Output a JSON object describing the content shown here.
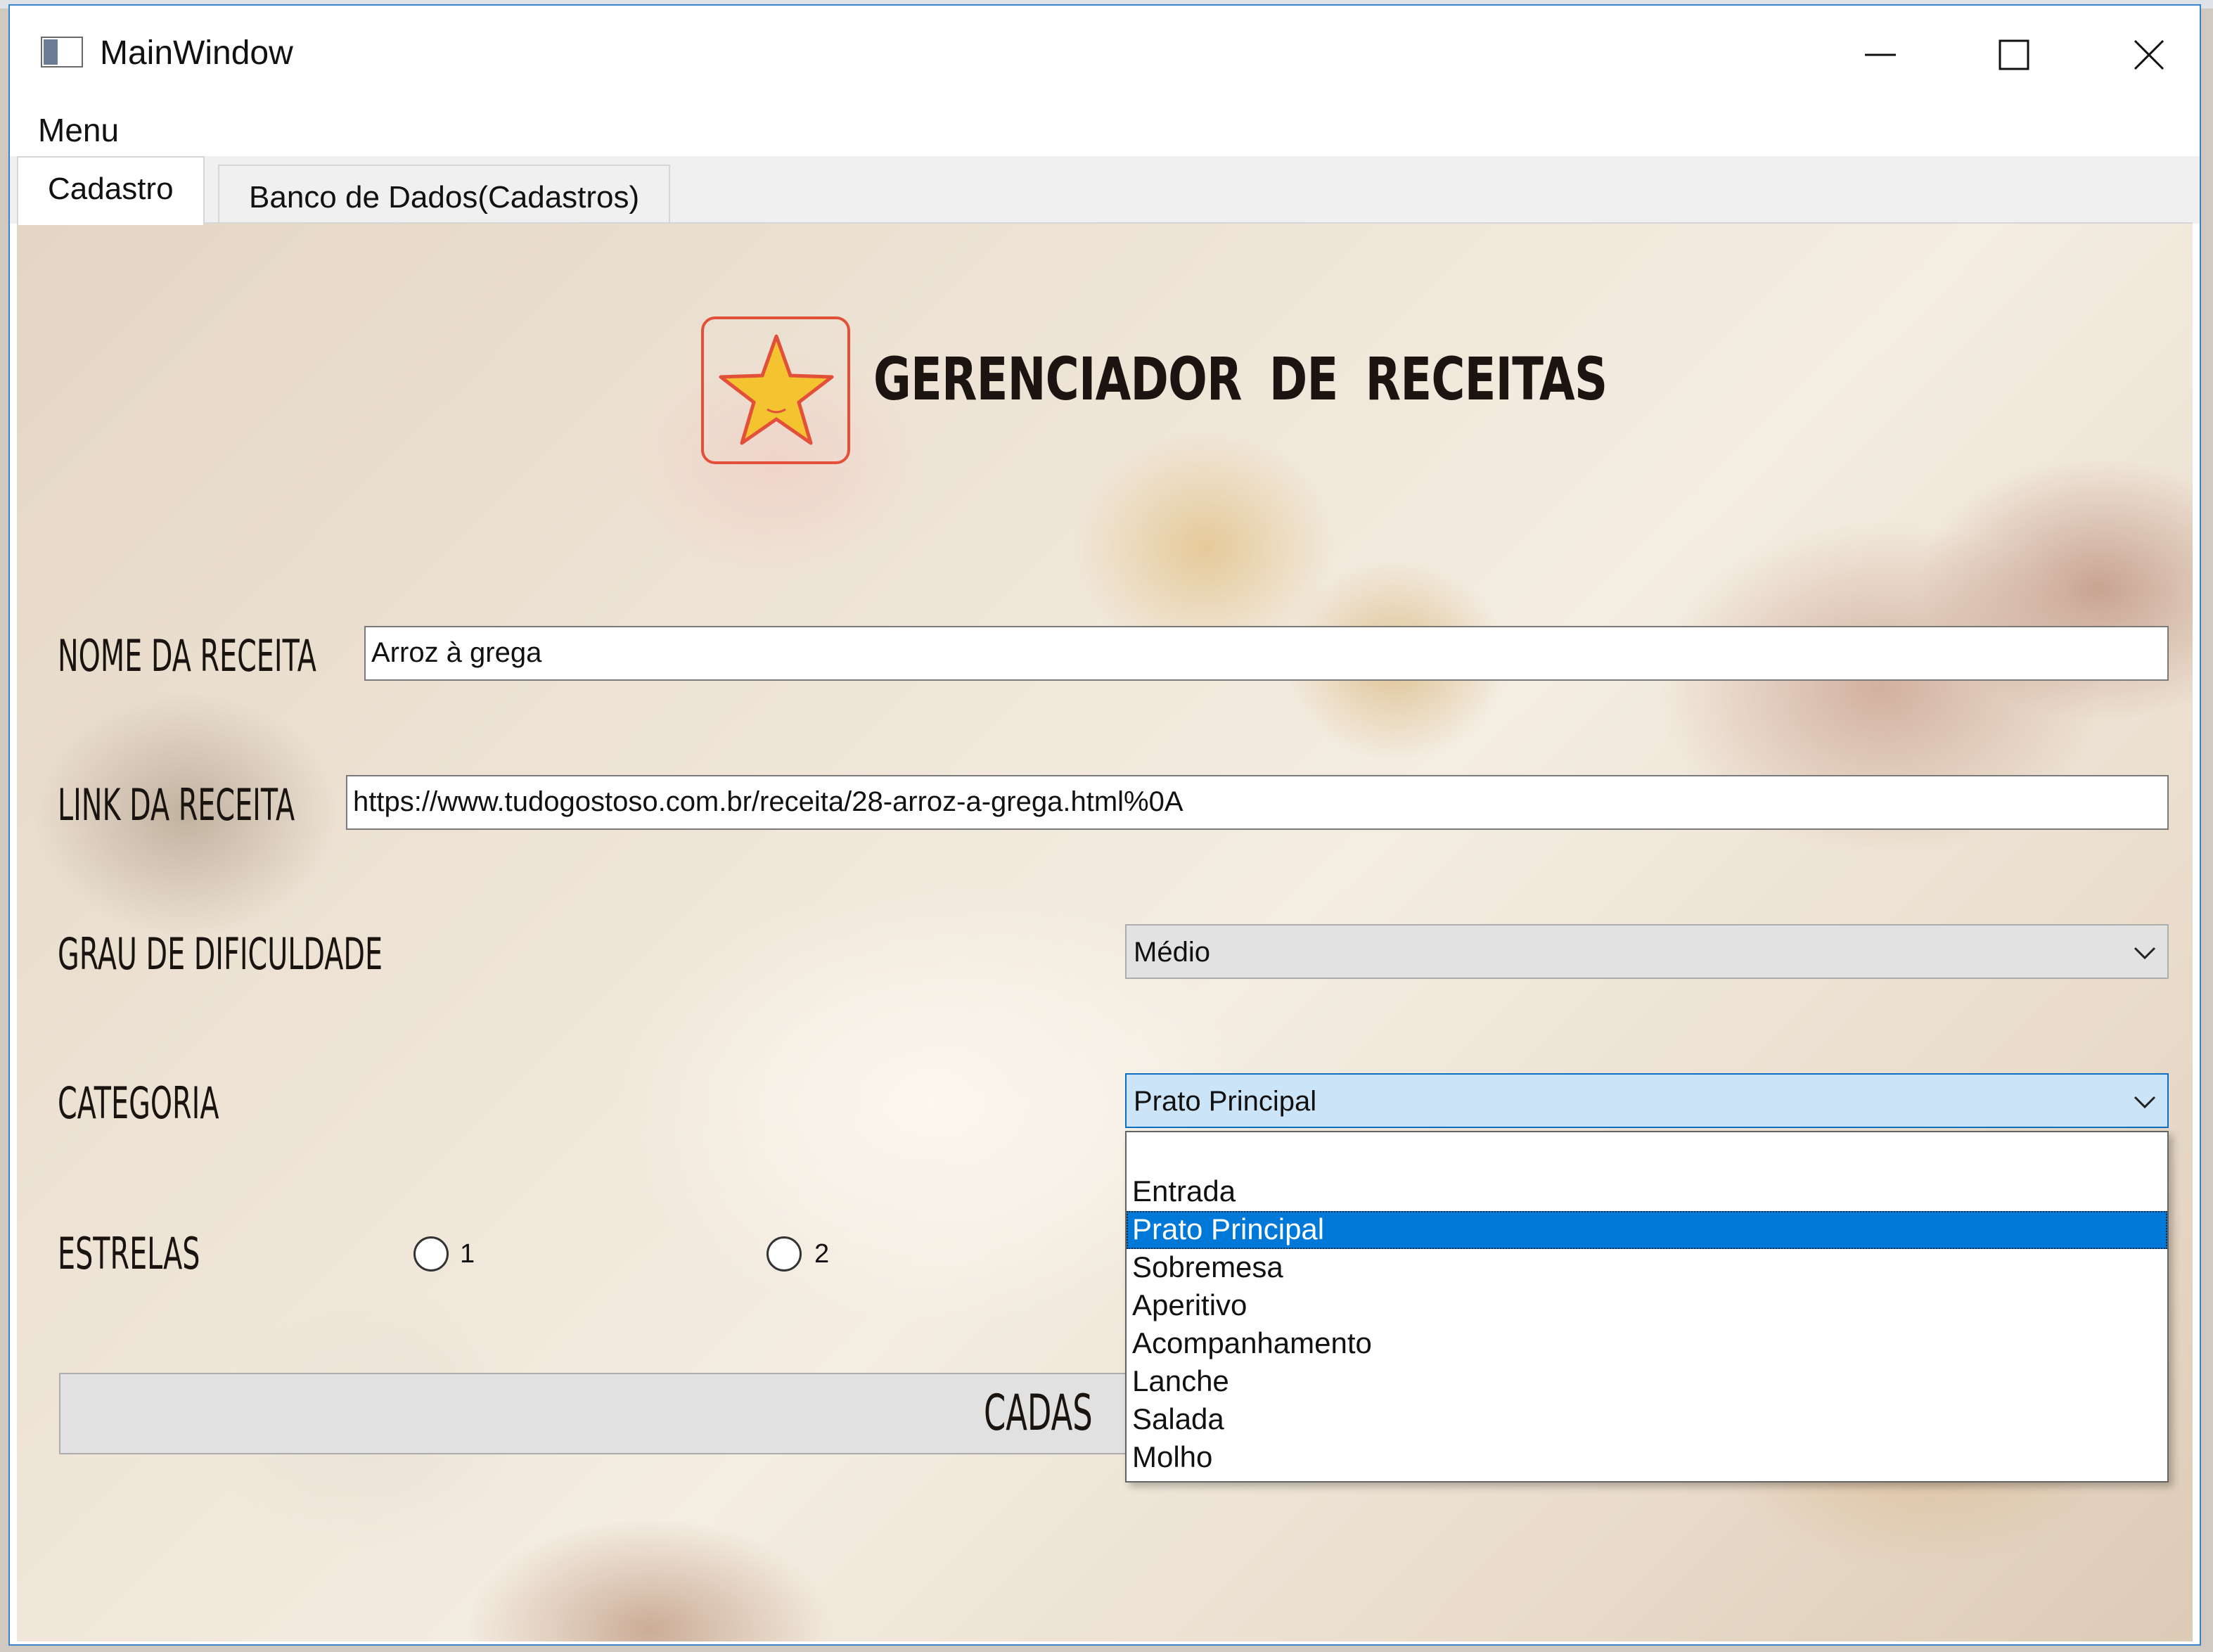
{
  "window": {
    "title": "MainWindow",
    "controls": {
      "minimize": "minimize",
      "maximize": "maximize",
      "close": "close"
    }
  },
  "menubar": {
    "menu_label": "Menu"
  },
  "tabs": [
    {
      "label": "Cadastro",
      "active": true
    },
    {
      "label": "Banco de Dados(Cadastros)",
      "active": false
    }
  ],
  "header": {
    "title": "GERENCIADOR DE RECEITAS",
    "logo_icon": "star-icon"
  },
  "form": {
    "name_label": "NOME DA RECEITA",
    "name_value": "Arroz à grega",
    "link_label": "LINK DA RECEITA",
    "link_value": "https://www.tudogostoso.com.br/receita/28-arroz-a-grega.html%0A",
    "difficulty_label": "GRAU DE DIFICULDADE",
    "difficulty_value": "Médio",
    "category_label": "CATEGORIA",
    "category_value": "Prato Principal",
    "stars_label": "ESTRELAS",
    "star_options": [
      "1",
      "2"
    ],
    "submit_label": "CADAS"
  },
  "category_dropdown": {
    "options": [
      "",
      "Entrada",
      "Prato Principal",
      "Sobremesa",
      "Aperitivo",
      "Acompanhamento",
      "Lanche",
      "Salada",
      "Molho"
    ],
    "selected": "Prato Principal"
  },
  "colors": {
    "window_border": "#3b83c9",
    "selection": "#0078d7",
    "logo_border": "#e3503a",
    "star_fill": "#f4c430"
  }
}
